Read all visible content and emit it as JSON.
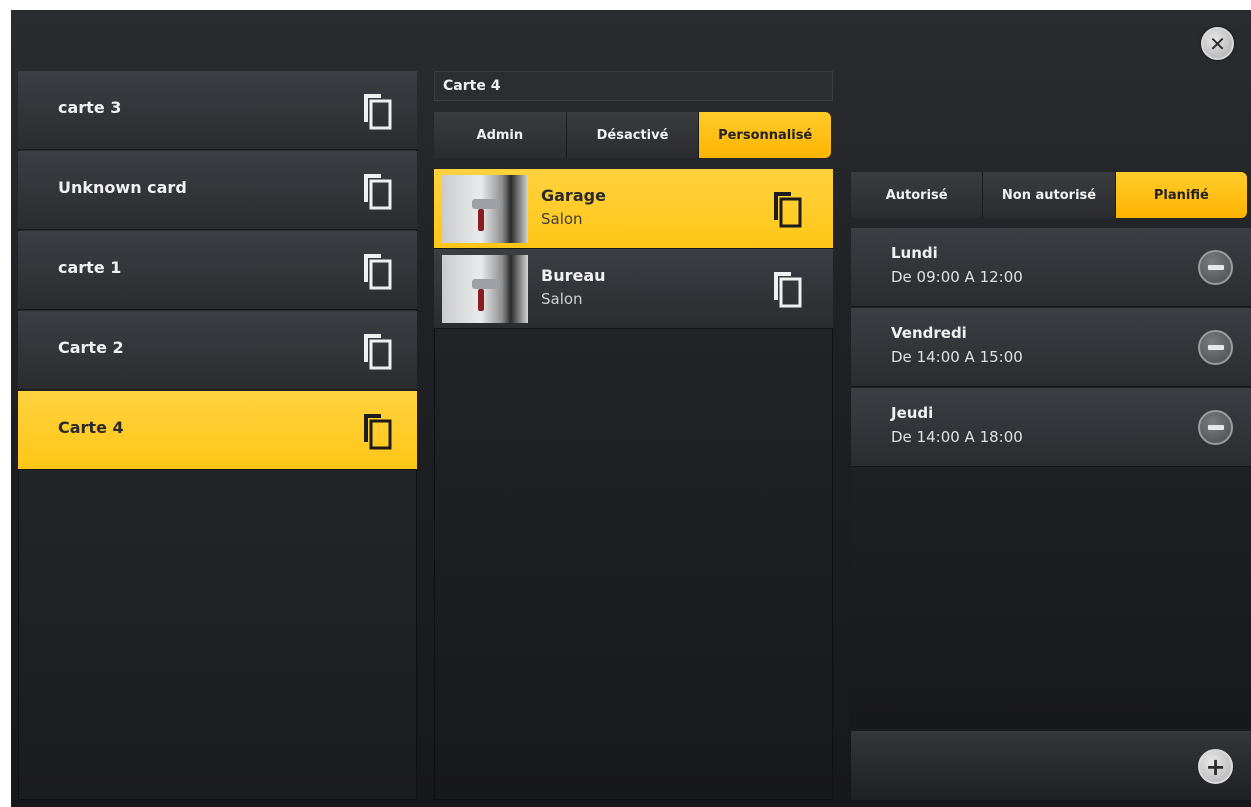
{
  "header": {
    "close_icon": "close-icon"
  },
  "cards": [
    {
      "label": "carte 3",
      "selected": false
    },
    {
      "label": "Unknown card",
      "selected": false
    },
    {
      "label": "carte 1",
      "selected": false
    },
    {
      "label": "Carte 2",
      "selected": false
    },
    {
      "label": "Carte 4",
      "selected": true
    }
  ],
  "detail": {
    "title": "Carte 4",
    "mode_tabs": [
      {
        "label": "Admin",
        "active": false
      },
      {
        "label": "Désactivé",
        "active": false
      },
      {
        "label": "Personnalisé",
        "active": true
      }
    ],
    "doors": [
      {
        "name": "Garage",
        "room": "Salon",
        "selected": true
      },
      {
        "name": "Bureau",
        "room": "Salon",
        "selected": false
      }
    ]
  },
  "access": {
    "tabs": [
      {
        "label": "Autorisé",
        "active": false
      },
      {
        "label": "Non autorisé",
        "active": false
      },
      {
        "label": "Planifié",
        "active": true
      }
    ],
    "schedules": [
      {
        "day": "Lundi",
        "time": "De 09:00 A 12:00"
      },
      {
        "day": "Vendredi",
        "time": "De 14:00 A 15:00"
      },
      {
        "day": "Jeudi",
        "time": "De 14:00 A 18:00"
      }
    ]
  },
  "colors": {
    "accent": "#ffc617",
    "panel": "#2a2c30",
    "background": "#1f2124"
  }
}
